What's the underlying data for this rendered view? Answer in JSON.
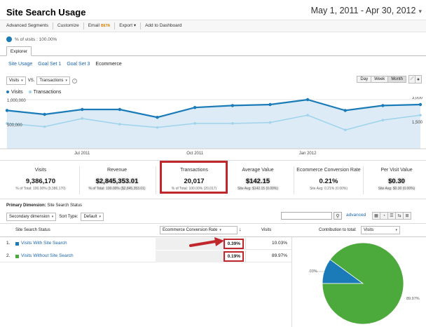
{
  "header": {
    "title": "Site Search Usage",
    "date_range": "May 1, 2011 - Apr 30, 2012"
  },
  "toolbar": {
    "advanced_segments": "Advanced Segments",
    "customize": "Customize",
    "email": "Email",
    "beta": "BETA",
    "export": "Export",
    "add_dashboard": "Add to Dashboard"
  },
  "segment": {
    "visits_pct": "% of visits : 100.00%"
  },
  "tabs": {
    "explorer": "Explorer"
  },
  "subtabs": [
    "Site Usage",
    "Goal Set 1",
    "Goal Set 3",
    "Ecommerce"
  ],
  "graph_controls": {
    "metric1": "Visits",
    "vs": "VS.",
    "metric2": "Transactions",
    "periods": [
      "Day",
      "Week",
      "Month"
    ],
    "active_period": "Month"
  },
  "legend": [
    {
      "name": "Visits",
      "color": "#1a7bb8"
    },
    {
      "name": "Transactions",
      "color": "#9fd3ec"
    }
  ],
  "chart_data": {
    "type": "line",
    "y_left_ticks": [
      "1,000,000",
      "500,000"
    ],
    "y_right_ticks": [
      "3,000",
      "1,500"
    ],
    "x_ticks": [
      "Jul 2011",
      "Oct 2011",
      "Jan 2012"
    ],
    "series": [
      {
        "name": "Visits",
        "values": [
          780000,
          700000,
          800000,
          800000,
          640000,
          840000,
          880000,
          900000,
          1000000,
          780000,
          880000,
          900000
        ]
      },
      {
        "name": "Transactions",
        "values": [
          1550,
          1350,
          1850,
          1500,
          1300,
          1550,
          1550,
          1600,
          2050,
          1150,
          1750,
          2050
        ]
      }
    ],
    "y_left_range": [
      0,
      1000000
    ],
    "y_right_range": [
      0,
      3000
    ]
  },
  "kpis": [
    {
      "label": "Visits",
      "value": "9,386,170",
      "sub": "% of Total: 100.00% (9,386,170)",
      "blurred": false
    },
    {
      "label": "Revenue",
      "value": "$2,845,353.01",
      "sub": "% of Total: 100.00% ($2,845,353.01)",
      "blurred": true
    },
    {
      "label": "Transactions",
      "value": "20,017",
      "sub": "% of Total: 100.00% (20,017)",
      "blurred": false
    },
    {
      "label": "Average Value",
      "value": "$142.15",
      "sub": "Site Avg: $142.15 (0.00%)",
      "blurred": true
    },
    {
      "label": "Ecommerce Conversion Rate",
      "value": "0.21%",
      "sub": "Site Avg: 0.21% (0.00%)",
      "blurred": false
    },
    {
      "label": "Per Visit Value",
      "value": "$0.30",
      "sub": "Site Avg: $0.30 (0.00%)",
      "blurred": true
    }
  ],
  "dimension": {
    "primary_label": "Primary Dimension:",
    "primary_value": "Site Search Status",
    "secondary": "Secondary dimension",
    "sort_label": "Sort Type:",
    "sort_value": "Default",
    "advanced": "advanced"
  },
  "table": {
    "col_status": "Site Search Status",
    "col_metric": "Ecommerce Conversion Rate",
    "col_visits": "Visits",
    "contribution_label": "Contribution to total:",
    "contribution_value": "Visits",
    "rows": [
      {
        "num": "1.",
        "name": "Visits With Site Search",
        "rate": "0.39%",
        "visits": "10.03%",
        "color": "#1a7bb8"
      },
      {
        "num": "2.",
        "name": "Visits Without Site Search",
        "rate": "0.19%",
        "visits": "89.97%",
        "color": "#4ca93b"
      }
    ]
  },
  "pie": {
    "slices": [
      {
        "label": "10.03%",
        "value": 10.03,
        "color": "#1a7bb8"
      },
      {
        "label": "89.97%",
        "value": 89.97,
        "color": "#4ca93b"
      }
    ]
  },
  "colors": {
    "highlight": "#c0272d",
    "link": "#1a66b0"
  }
}
